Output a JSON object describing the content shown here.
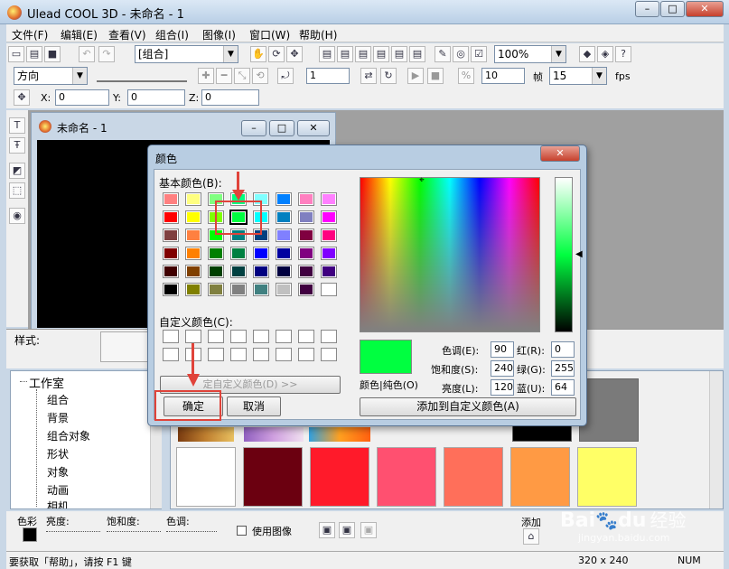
{
  "app": {
    "title": "Ulead COOL 3D - 未命名 - 1"
  },
  "menu": [
    "文件(F)",
    "编辑(E)",
    "查看(V)",
    "组合(I)",
    "图像(I)",
    "窗口(W)",
    "帮助(H)"
  ],
  "toolbar1": {
    "group_combo": "[组合]",
    "zoom": "100%"
  },
  "toolbar2": {
    "direction": "方向",
    "frame_value": "1",
    "speed_value": "10",
    "frames_label": "帧",
    "fps_value": "15",
    "fps_label": "fps"
  },
  "toolbar3": {
    "x_label": "X:",
    "x_value": "0",
    "y_label": "Y:",
    "y_value": "0",
    "z_label": "Z:",
    "z_value": "0"
  },
  "doc_window": {
    "title": "未命名 - 1"
  },
  "style_label": "样式:",
  "tree": {
    "root": "工作室",
    "items": [
      "组合",
      "背景",
      "组合对象",
      "形状",
      "对象",
      "动画",
      "相机"
    ]
  },
  "palette_swatches": [
    "#ffffff",
    "#6b0010",
    "#ff1a2a",
    "#ff5070",
    "#ff6f5a",
    "#ff9a44",
    "#ffff66"
  ],
  "bottom_controls": {
    "color": "色彩",
    "brightness": "亮度:",
    "saturation": "饱和度:",
    "hue": "色调:",
    "use_image": "使用图像",
    "add": "添加"
  },
  "statusbar": {
    "hint": "要获取「帮助」，请按 F1 键",
    "size": "320 x 240",
    "num": "NUM"
  },
  "dialog": {
    "title": "颜色",
    "basic_colors_label": "基本颜色(B):",
    "custom_colors_label": "自定义颜色(C):",
    "define_custom_button": "定自定义颜色(D) >>",
    "ok_button": "确定",
    "cancel_button": "取消",
    "color_solid_label": "颜色|纯色(O)",
    "hue_label": "色调(E):",
    "hue_value": "90",
    "sat_label": "饱和度(S):",
    "sat_value": "240",
    "lum_label": "亮度(L):",
    "lum_value": "120",
    "red_label": "红(R):",
    "red_value": "0",
    "green_label": "绿(G):",
    "green_value": "255",
    "blue_label": "蓝(U):",
    "blue_value": "64",
    "add_custom_button": "添加到自定义颜色(A)",
    "selected_color": "#00ff40",
    "basic_colors": [
      "#ff8080",
      "#ffff80",
      "#80ff80",
      "#00ff80",
      "#80ffff",
      "#0080ff",
      "#ff80c0",
      "#ff80ff",
      "#ff0000",
      "#ffff00",
      "#80ff00",
      "#00ff40",
      "#00ffff",
      "#0080c0",
      "#8080c0",
      "#ff00ff",
      "#804040",
      "#ff8040",
      "#00ff00",
      "#008080",
      "#004080",
      "#8080ff",
      "#800040",
      "#ff0080",
      "#800000",
      "#ff8000",
      "#008000",
      "#008040",
      "#0000ff",
      "#0000a0",
      "#800080",
      "#8000ff",
      "#400000",
      "#804000",
      "#004000",
      "#004040",
      "#000080",
      "#000040",
      "#400040",
      "#400080",
      "#000000",
      "#808000",
      "#808040",
      "#808080",
      "#408080",
      "#c0c0c0",
      "#400040",
      "#ffffff"
    ]
  },
  "watermark": {
    "brand": "Bai",
    "brand2": "du",
    "suffix": "经验",
    "url": "jingyan.baidu.com"
  }
}
